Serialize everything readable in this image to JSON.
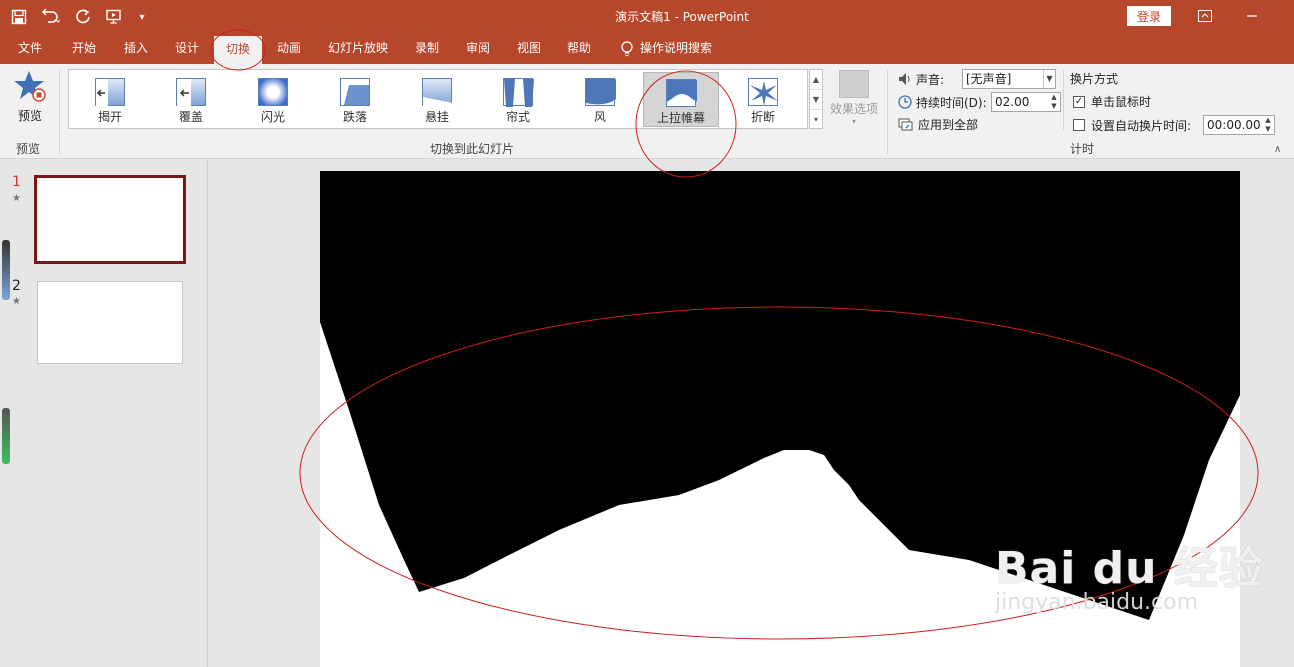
{
  "app": {
    "title": "演示文稿1  -  PowerPoint",
    "login_label": "登录",
    "accent_color": "#b7472a",
    "annotation_color": "#cc1f1f"
  },
  "tabs": [
    {
      "label": "文件",
      "active": false
    },
    {
      "label": "开始",
      "active": false
    },
    {
      "label": "插入",
      "active": false
    },
    {
      "label": "设计",
      "active": false
    },
    {
      "label": "切换",
      "active": true
    },
    {
      "label": "动画",
      "active": false
    },
    {
      "label": "幻灯片放映",
      "active": false
    },
    {
      "label": "录制",
      "active": false
    },
    {
      "label": "审阅",
      "active": false
    },
    {
      "label": "视图",
      "active": false
    },
    {
      "label": "帮助",
      "active": false
    }
  ],
  "search_label": "操作说明搜索",
  "ribbon": {
    "preview": {
      "label": "预览",
      "group_label": "预览"
    },
    "transitions": {
      "group_label": "切换到此幻灯片",
      "items": [
        {
          "label": "揭开",
          "icon": "uncover-icon"
        },
        {
          "label": "覆盖",
          "icon": "cover-icon"
        },
        {
          "label": "闪光",
          "icon": "flash-icon"
        },
        {
          "label": "跌落",
          "icon": "fall-icon"
        },
        {
          "label": "悬挂",
          "icon": "drape-icon"
        },
        {
          "label": "帘式",
          "icon": "curtains-icon"
        },
        {
          "label": "风",
          "icon": "wind-icon"
        },
        {
          "label": "上拉帷幕",
          "icon": "prestige-icon",
          "selected": true
        },
        {
          "label": "折断",
          "icon": "fracture-icon"
        }
      ],
      "effect_options_label": "效果选项"
    },
    "timing": {
      "sound_label": "声音:",
      "sound_value": "[无声音]",
      "duration_label": "持续时间(D):",
      "duration_value": "02.00",
      "apply_all_label": "应用到全部",
      "advance_title": "换片方式",
      "on_click_label": "单击鼠标时",
      "on_click_checked": true,
      "after_label": "设置自动换片时间:",
      "after_checked": false,
      "after_value": "00:00.00",
      "group_label": "计时"
    }
  },
  "slides": [
    {
      "number": "1",
      "star": "★",
      "selected": true
    },
    {
      "number": "2",
      "star": "★",
      "selected": false
    }
  ],
  "watermark": {
    "line1": "Bai du 经验",
    "line2": "jingyan.baidu.com"
  }
}
